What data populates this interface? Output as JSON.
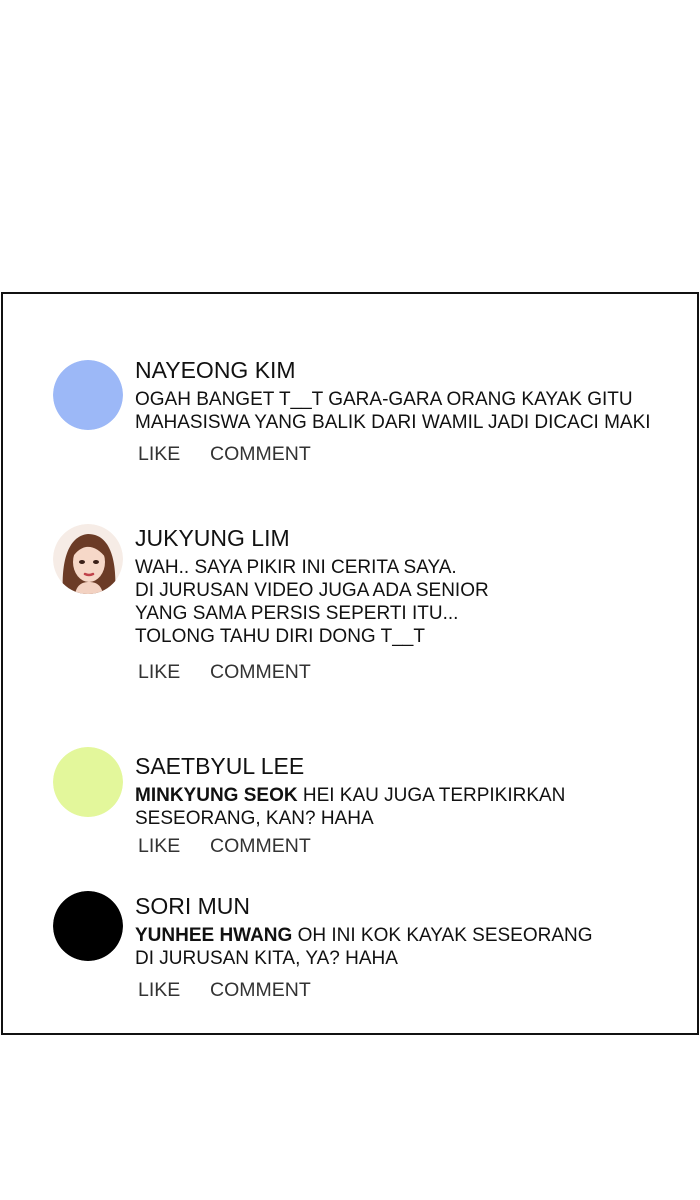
{
  "comments": [
    {
      "name": "NAYEONG KIM",
      "avatar": {
        "type": "solid",
        "color": "#9cb8f7"
      },
      "mention": "",
      "lines": [
        "OGAH BANGET T__T GARA-GARA ORANG KAYAK GITU",
        "MAHASISWA YANG BALIK DARI WAMIL JADI DICACI MAKI"
      ],
      "like_label": "LIKE",
      "comment_label": "COMMENT"
    },
    {
      "name": "JUKYUNG LIM",
      "avatar": {
        "type": "portrait",
        "color": "#f1d9cb"
      },
      "mention": "",
      "lines": [
        "WAH.. SAYA PIKIR INI CERITA SAYA.",
        "DI JURUSAN VIDEO JUGA ADA SENIOR",
        "YANG SAMA PERSIS SEPERTI ITU...",
        "TOLONG TAHU DIRI DONG T__T"
      ],
      "like_label": "LIKE",
      "comment_label": "COMMENT"
    },
    {
      "name": "SAETBYUL LEE",
      "avatar": {
        "type": "solid",
        "color": "#e3f79b"
      },
      "mention": "MINKYUNG SEOK",
      "lines": [
        "HEI KAU JUGA TERPIKIRKAN",
        "SESEORANG, KAN? HAHA"
      ],
      "like_label": "LIKE",
      "comment_label": "COMMENT"
    },
    {
      "name": "SORI MUN",
      "avatar": {
        "type": "solid",
        "color": "#000000"
      },
      "mention": "YUNHEE HWANG",
      "lines": [
        "OH INI KOK KAYAK SESEORANG",
        "DI JURUSAN KITA, YA? HAHA"
      ],
      "like_label": "LIKE",
      "comment_label": "COMMENT"
    }
  ]
}
